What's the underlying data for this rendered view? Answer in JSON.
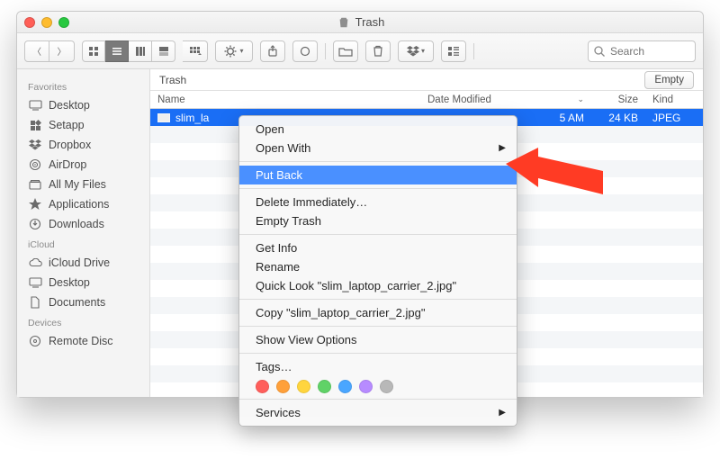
{
  "window": {
    "title": "Trash"
  },
  "toolbar": {
    "search_placeholder": "Search"
  },
  "sidebar": {
    "groups": [
      {
        "label": "Favorites",
        "items": [
          {
            "label": "Desktop",
            "icon": "desktop"
          },
          {
            "label": "Setapp",
            "icon": "setapp"
          },
          {
            "label": "Dropbox",
            "icon": "dropbox"
          },
          {
            "label": "AirDrop",
            "icon": "airdrop"
          },
          {
            "label": "All My Files",
            "icon": "allfiles"
          },
          {
            "label": "Applications",
            "icon": "apps"
          },
          {
            "label": "Downloads",
            "icon": "downloads"
          }
        ]
      },
      {
        "label": "iCloud",
        "items": [
          {
            "label": "iCloud Drive",
            "icon": "cloud"
          },
          {
            "label": "Desktop",
            "icon": "desktop"
          },
          {
            "label": "Documents",
            "icon": "docs"
          }
        ]
      },
      {
        "label": "Devices",
        "items": [
          {
            "label": "Remote Disc",
            "icon": "disc"
          }
        ]
      }
    ]
  },
  "pathbar": {
    "location": "Trash",
    "empty_label": "Empty"
  },
  "columns": {
    "name": "Name",
    "date": "Date Modified",
    "size": "Size",
    "kind": "Kind"
  },
  "files": [
    {
      "name": "slim_la",
      "date": "5 AM",
      "size": "24 KB",
      "kind": "JPEG"
    }
  ],
  "context_menu": {
    "open": "Open",
    "open_with": "Open With",
    "put_back": "Put Back",
    "delete_imm": "Delete Immediately…",
    "empty_trash": "Empty Trash",
    "get_info": "Get Info",
    "rename": "Rename",
    "quick_look": "Quick Look \"slim_laptop_carrier_2.jpg\"",
    "copy": "Copy \"slim_laptop_carrier_2.jpg\"",
    "show_view": "Show View Options",
    "tags": "Tags…",
    "services": "Services",
    "tag_colors": [
      "#ff5e5b",
      "#ffa03a",
      "#ffd53e",
      "#60d267",
      "#4aa6ff",
      "#b78bff",
      "#b8b8b8"
    ]
  }
}
